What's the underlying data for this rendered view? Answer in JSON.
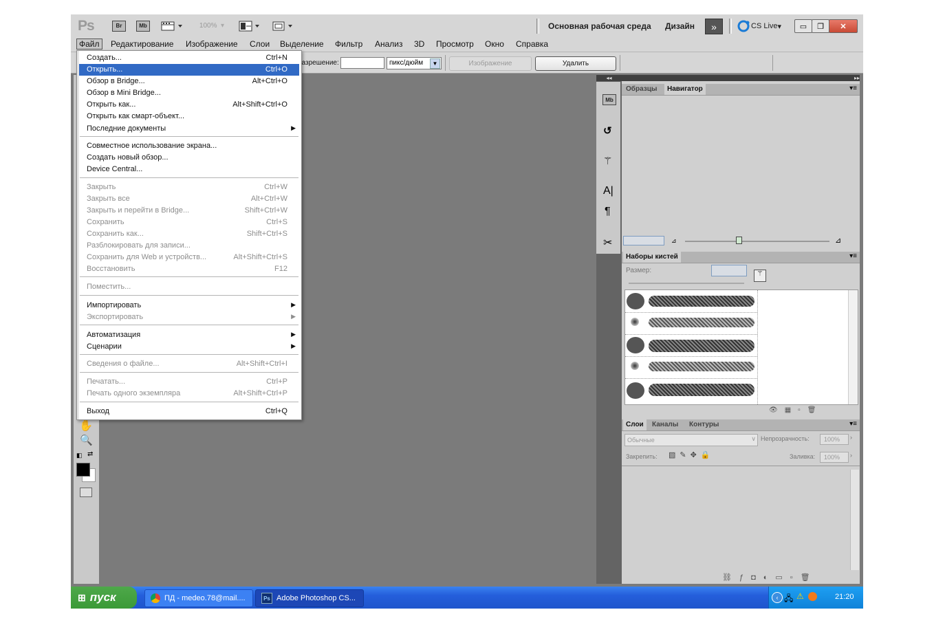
{
  "appbar": {
    "logo": "Ps",
    "icon_br": "Br",
    "icon_mb": "Mb",
    "zoom": "100%",
    "workspace_main": "Основная рабочая среда",
    "workspace_design": "Дизайн",
    "cslive": "CS Live"
  },
  "menubar": {
    "items": [
      "Файл",
      "Редактирование",
      "Изображение",
      "Слои",
      "Выделение",
      "Фильтр",
      "Анализ",
      "3D",
      "Просмотр",
      "Окно",
      "Справка"
    ]
  },
  "options": {
    "resolution_label": "разрешение:",
    "unit_select": "пикс/дюйм",
    "image_button": "Изображение",
    "delete_button": "Удалить"
  },
  "file_menu": {
    "create": {
      "label": "Создать...",
      "shortcut": "Ctrl+N"
    },
    "open": {
      "label": "Открыть...",
      "shortcut": "Ctrl+O"
    },
    "browse_bridge": {
      "label": "Обзор в Bridge...",
      "shortcut": "Alt+Ctrl+O"
    },
    "browse_mini": {
      "label": "Обзор в Mini Bridge...",
      "shortcut": ""
    },
    "open_as": {
      "label": "Открыть как...",
      "shortcut": "Alt+Shift+Ctrl+O"
    },
    "open_smart": {
      "label": "Открыть как смарт-объект...",
      "shortcut": ""
    },
    "recent": {
      "label": "Последние документы",
      "shortcut": ""
    },
    "share_screen": {
      "label": "Совместное использование экрана...",
      "shortcut": ""
    },
    "new_review": {
      "label": "Создать новый обзор...",
      "shortcut": ""
    },
    "device_central": {
      "label": "Device Central...",
      "shortcut": ""
    },
    "close": {
      "label": "Закрыть",
      "shortcut": "Ctrl+W"
    },
    "close_all": {
      "label": "Закрыть все",
      "shortcut": "Alt+Ctrl+W"
    },
    "close_bridge": {
      "label": "Закрыть и перейти в Bridge...",
      "shortcut": "Shift+Ctrl+W"
    },
    "save": {
      "label": "Сохранить",
      "shortcut": "Ctrl+S"
    },
    "save_as": {
      "label": "Сохранить как...",
      "shortcut": "Shift+Ctrl+S"
    },
    "checkin": {
      "label": "Разблокировать для записи...",
      "shortcut": ""
    },
    "save_web": {
      "label": "Сохранить для Web и устройств...",
      "shortcut": "Alt+Shift+Ctrl+S"
    },
    "revert": {
      "label": "Восстановить",
      "shortcut": "F12"
    },
    "place": {
      "label": "Поместить...",
      "shortcut": ""
    },
    "import": {
      "label": "Импортировать",
      "shortcut": ""
    },
    "export": {
      "label": "Экспортировать",
      "shortcut": ""
    },
    "automate": {
      "label": "Автоматизация",
      "shortcut": ""
    },
    "scripts": {
      "label": "Сценарии",
      "shortcut": ""
    },
    "file_info": {
      "label": "Сведения о файле...",
      "shortcut": "Alt+Shift+Ctrl+I"
    },
    "print": {
      "label": "Печатать...",
      "shortcut": "Ctrl+P"
    },
    "print_one": {
      "label": "Печать одного экземпляра",
      "shortcut": "Alt+Shift+Ctrl+P"
    },
    "exit": {
      "label": "Выход",
      "shortcut": "Ctrl+Q"
    }
  },
  "panels": {
    "tab_swatches": "Образцы",
    "tab_navigator": "Навигатор",
    "brush_presets": "Наборы кистей",
    "brush_size": "Размер:",
    "tab_layers": "Слои",
    "tab_channels": "Каналы",
    "tab_paths": "Контуры",
    "blend_mode": "Обычные",
    "opacity_label": "Непрозрачность:",
    "opacity_value": "100%",
    "lock_label": "Закрепить:",
    "fill_label": "Заливка:",
    "fill_value": "100%"
  },
  "dock": {
    "mb": "Mb"
  },
  "taskbar": {
    "start": "пуск",
    "task1": "ПД - medeo.78@mail....",
    "task2": "Adobe Photoshop CS...",
    "clock": "21:20"
  }
}
